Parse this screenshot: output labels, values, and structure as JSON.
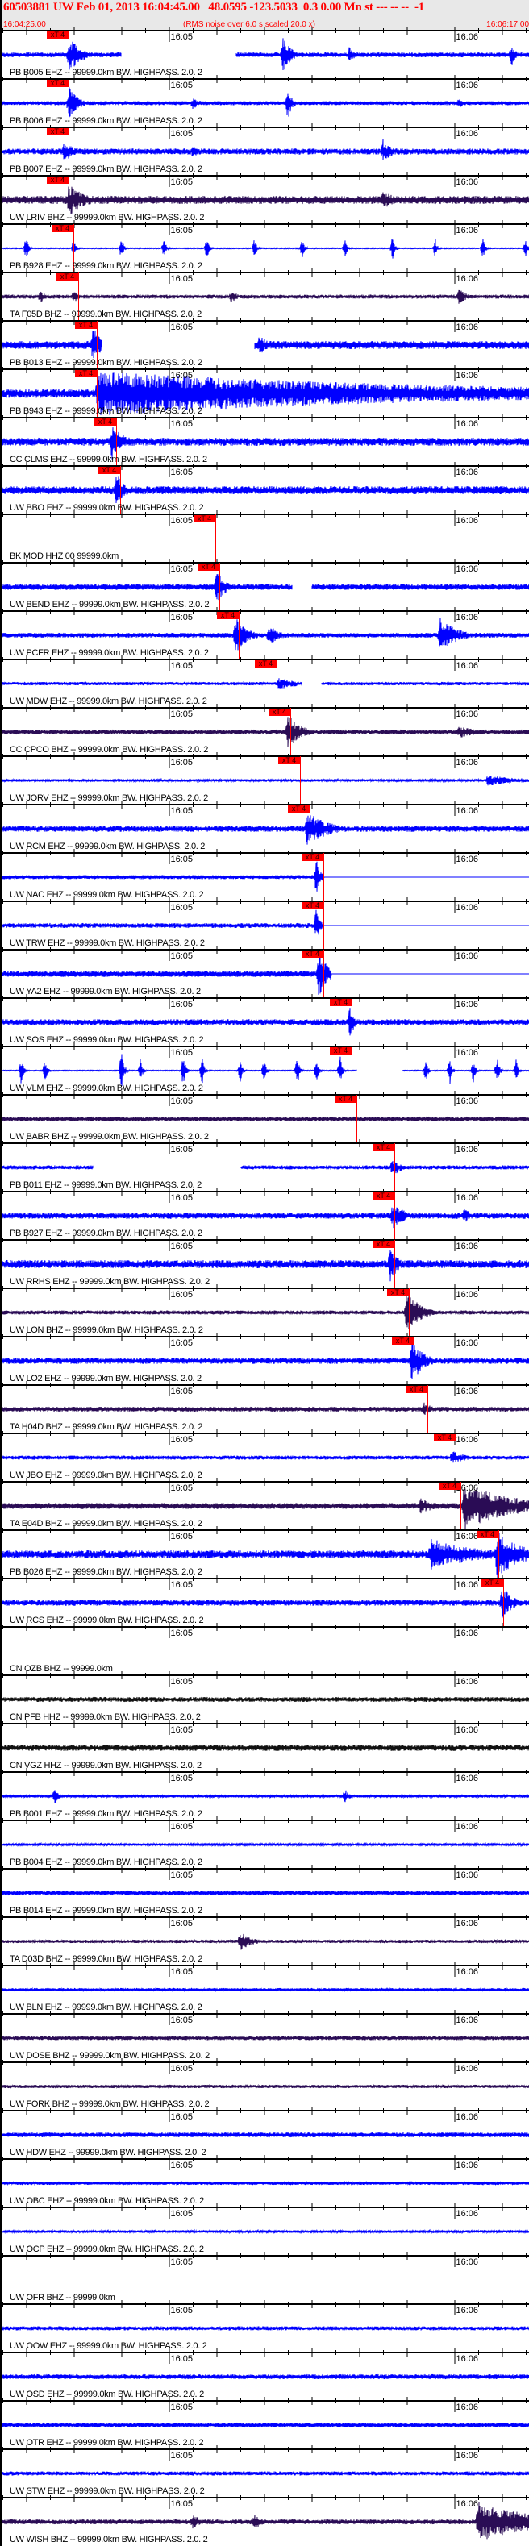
{
  "header": {
    "title": "60503881 UW Feb 01, 2013 16:04:45.00   48.0595 -123.5033  0.3 0.00 Mn st --- -- --  -1",
    "start_time": "16:04:25.00",
    "scale_note": "(RMS noise over 6.0 s scaled 20.0 x)",
    "end_time": "16:06:17.00"
  },
  "time_axis": {
    "duration_s": 112,
    "tick_interval_s": 5,
    "minute_labels": [
      {
        "label": "16:05",
        "t": 35
      },
      {
        "label": "16:06",
        "t": 95
      }
    ]
  },
  "marker_label": "xT 4",
  "colors": {
    "blue": "#0000ff",
    "dark": "#2a0c55",
    "black": "#111111",
    "marker": "#ff0000",
    "header_text": "#ff0000"
  },
  "panels": [
    {
      "label": "PB B005 EHZ -- 99999.0km BW. HIGHPASS. 2.0. 2",
      "color": "blue",
      "base": 0.12,
      "pick": 13.9,
      "ev": [
        [
          14,
          0.9,
          3
        ],
        [
          59,
          0.9,
          2
        ],
        [
          73,
          0.5,
          1
        ],
        [
          107,
          0.6,
          1
        ]
      ],
      "gaps": [
        [
          25,
          49
        ]
      ]
    },
    {
      "label": "PB B006 EHZ -- 99999.0km BW. HIGHPASS. 2.0. 2",
      "color": "blue",
      "base": 0.1,
      "pick": 13.9,
      "ev": [
        [
          14,
          0.9,
          2
        ],
        [
          40,
          0.3,
          2
        ],
        [
          60,
          0.9,
          1
        ],
        [
          96,
          0.3,
          1
        ]
      ]
    },
    {
      "label": "PB B007 EHZ -- 99999.0km BW. HIGHPASS. 2.0. 2",
      "color": "blue",
      "base": 0.15,
      "pick": 13.9,
      "ev": [
        [
          13,
          0.5,
          3
        ],
        [
          40,
          0.3,
          2
        ],
        [
          80,
          0.6,
          2
        ]
      ]
    },
    {
      "label": "UW LRIV BHZ -- 99999.0km BW. HIGHPASS. 2.0. 2",
      "color": "dark",
      "base": 0.2,
      "pick": 13.9,
      "ev": [
        [
          14,
          0.8,
          4
        ],
        [
          80,
          0.5,
          3
        ]
      ]
    },
    {
      "label": "PB B928 EHZ -- 99999.0km BW. HIGHPASS. 2.0. 2",
      "color": "blue",
      "base": 0.02,
      "pick": 14.9,
      "ev": [
        [
          5,
          0.6,
          0.5
        ],
        [
          15,
          0.5,
          0.5
        ],
        [
          25,
          0.6,
          0.5
        ],
        [
          34,
          0.5,
          0.5
        ],
        [
          43,
          0.6,
          0.5
        ],
        [
          53,
          0.5,
          0.5
        ],
        [
          63,
          0.6,
          0.5
        ],
        [
          72,
          0.5,
          0.5
        ],
        [
          82,
          0.6,
          0.5
        ],
        [
          91,
          0.5,
          0.5
        ],
        [
          101,
          0.6,
          0.5
        ],
        [
          110,
          0.5,
          0.5
        ]
      ]
    },
    {
      "label": "TA F05D BHZ -- 99999.0km BW. HIGHPASS. 2.0. 2",
      "color": "dark",
      "base": 0.1,
      "pick": 15.9,
      "ev": [
        [
          8,
          0.4,
          1
        ],
        [
          15,
          0.4,
          1
        ],
        [
          48,
          0.3,
          2
        ],
        [
          96,
          0.4,
          2
        ]
      ]
    },
    {
      "label": "PB B013 EHZ -- 99999.0km BW. HIGHPASS. 2.0. 2",
      "color": "blue",
      "base": 0.2,
      "pick": 19.8,
      "ev": [
        [
          19,
          1,
          2
        ],
        [
          54,
          0.6,
          2
        ]
      ],
      "gaps": [
        [
          21,
          53
        ]
      ]
    },
    {
      "label": "PB B943 EHZ -- 99999.0km BW. HIGHPASS. 2.0. 2",
      "color": "blue",
      "base": 0.22,
      "pick": 19.8,
      "ev": [
        [
          20,
          1.1,
          90
        ]
      ]
    },
    {
      "label": "CC CLMS EHZ -- 99999.0km BW. HIGHPASS. 2.0. 2",
      "color": "blue",
      "base": 0.2,
      "pick": 23.9,
      "ev": [
        [
          23,
          0.9,
          3
        ]
      ]
    },
    {
      "label": "UW BBO EHZ -- 99999.0km BW. HIGHPASS. 2.0. 2",
      "color": "blue",
      "base": 0.2,
      "pick": 24.7,
      "ev": [
        [
          24,
          0.9,
          2
        ]
      ]
    },
    {
      "label": "BK MOD HHZ 00 99999.0km",
      "color": "blue",
      "base": 0,
      "pick": 44.7,
      "empty": true
    },
    {
      "label": "UW BEND EHZ -- 99999.0km BW. HIGHPASS. 2.0. 2",
      "color": "blue",
      "base": 0.15,
      "pick": 45.6,
      "ev": [
        [
          45,
          0.9,
          2
        ]
      ],
      "gaps": [
        [
          61,
          65
        ]
      ]
    },
    {
      "label": "UW PCFR EHZ -- 99999.0km BW. HIGHPASS. 2.0. 2",
      "color": "blue",
      "base": 0.12,
      "pick": 49.7,
      "ev": [
        [
          49,
          0.9,
          3
        ],
        [
          56,
          0.5,
          3
        ],
        [
          92,
          0.9,
          4
        ]
      ]
    },
    {
      "label": "UW MDW EHZ -- 99999.0km BW. HIGHPASS. 2.0. 2",
      "color": "blue",
      "base": 0.08,
      "pick": 57.6,
      "ev": [
        [
          58,
          0.3,
          5
        ]
      ],
      "gaps": [
        [
          63,
          67
        ]
      ]
    },
    {
      "label": "CC CPCO BHZ -- 99999.0km BW. HIGHPASS. 2.0. 2",
      "color": "dark",
      "base": 0.12,
      "pick": 60.5,
      "ev": [
        [
          60,
          0.9,
          3
        ],
        [
          96,
          0.3,
          5
        ]
      ]
    },
    {
      "label": "UW JORV EHZ -- 99999.0km BW. HIGHPASS. 2.0. 2",
      "color": "blue",
      "base": 0.06,
      "pick": 62.5,
      "ev": [
        [
          102,
          0.3,
          8
        ]
      ]
    },
    {
      "label": "UW RCM EHZ -- 99999.0km BW. HIGHPASS. 2.0. 2",
      "color": "blue",
      "base": 0.15,
      "pick": 64.6,
      "ev": [
        [
          64,
          0.9,
          5
        ],
        [
          113,
          0.9,
          3
        ]
      ]
    },
    {
      "label": "UW NAC EHZ -- 99999.0km BW. HIGHPASS. 2.0. 2",
      "color": "blue",
      "base": 0.1,
      "pick": 67.5,
      "ev": [
        [
          66,
          0.9,
          1
        ]
      ],
      "flat_after": 67.5
    },
    {
      "label": "UW TRW EHZ -- 99999.0km BW. HIGHPASS. 2.0. 2",
      "color": "blue",
      "base": 0.12,
      "pick": 67.5,
      "ev": [
        [
          66,
          0.9,
          1
        ]
      ],
      "flat_after": 67.5
    },
    {
      "label": "UW YA2 EHZ -- 99999.0km BW. HIGHPASS. 2.0. 2",
      "color": "blue",
      "base": 0.15,
      "pick": 67.5,
      "ev": [
        [
          66.5,
          1.3,
          2
        ]
      ],
      "flat_after": 69
    },
    {
      "label": "UW SOS EHZ -- 99999.0km BW. HIGHPASS. 2.0. 2",
      "color": "blue",
      "base": 0.15,
      "pick": 73.4,
      "ev": [
        [
          73,
          0.9,
          1
        ]
      ]
    },
    {
      "label": "UW VLM EHZ -- 99999.0km BW. HIGHPASS. 2.0. 2",
      "color": "blue",
      "base": 0.02,
      "pick": 73.4,
      "ev": [
        [
          4,
          0.8,
          0.5
        ],
        [
          9,
          0.6,
          0.5
        ],
        [
          25,
          1,
          0.6
        ],
        [
          29,
          0.6,
          0.5
        ],
        [
          38,
          1,
          0.6
        ],
        [
          42,
          0.7,
          0.5
        ],
        [
          50,
          0.6,
          0.5
        ],
        [
          55,
          0.6,
          0.5
        ],
        [
          62,
          0.8,
          0.5
        ],
        [
          66,
          0.6,
          0.5
        ],
        [
          71,
          0.8,
          0.5
        ],
        [
          89,
          0.6,
          0.5
        ],
        [
          94,
          0.8,
          0.5
        ],
        [
          99,
          0.6,
          0.5
        ],
        [
          104,
          0.7,
          0.5
        ],
        [
          108,
          0.6,
          0.5
        ]
      ],
      "gaps": [
        [
          74.5,
          84
        ]
      ]
    },
    {
      "label": "UW BABR BHZ -- 99999.0km BW. HIGHPASS. 2.0. 2",
      "color": "dark",
      "base": 0.12,
      "pick": 74.4
    },
    {
      "label": "PB B011 EHZ -- 99999.0km BW. HIGHPASS. 2.0. 2",
      "color": "blue",
      "base": 0.1,
      "pick": 82.4,
      "ev": [
        [
          82,
          0.5,
          2
        ]
      ],
      "gaps": [
        [
          19,
          50
        ]
      ]
    },
    {
      "label": "PB B927 EHZ -- 99999.0km BW. HIGHPASS. 2.0. 2",
      "color": "blue",
      "base": 0.15,
      "pick": 82.4,
      "ev": [
        [
          82,
          0.7,
          3
        ],
        [
          97,
          0.4,
          2
        ]
      ]
    },
    {
      "label": "UW RRHS EHZ -- 99999.0km BW. HIGHPASS. 2.0. 2",
      "color": "blue",
      "base": 0.2,
      "pick": 82.4,
      "ev": [
        [
          81.5,
          0.9,
          2
        ]
      ]
    },
    {
      "label": "UW LON BHZ -- 99999.0km BW. HIGHPASS. 2.0. 2",
      "color": "dark",
      "base": 0.1,
      "pick": 85.4,
      "ev": [
        [
          85,
          1.2,
          3
        ]
      ]
    },
    {
      "label": "UW LO2 EHZ -- 99999.0km BW. HIGHPASS. 2.0. 2",
      "color": "blue",
      "base": 0.15,
      "pick": 86.4,
      "ev": [
        [
          86,
          1.1,
          3
        ]
      ]
    },
    {
      "label": "TA H04D BHZ -- 99999.0km BW. HIGHPASS. 2.0. 2",
      "color": "dark",
      "base": 0.12,
      "pick": 89.3,
      "ev": [
        [
          88.5,
          0.4,
          2
        ]
      ]
    },
    {
      "label": "UW JBO EHZ -- 99999.0km BW. HIGHPASS. 2.0. 2",
      "color": "blue",
      "base": 0.1,
      "pick": 95.3,
      "ev": [
        [
          94.5,
          0.4,
          3
        ]
      ]
    },
    {
      "label": "TA E04D BHZ -- 99999.0km BW. HIGHPASS. 2.0. 2",
      "color": "dark",
      "base": 0.15,
      "pick": 96.3,
      "ev": [
        [
          97,
          1.2,
          12
        ],
        [
          88,
          0.5,
          3
        ]
      ]
    },
    {
      "label": "PB B026 EHZ -- 99999.0km BW. HIGHPASS. 2.0. 2",
      "color": "blue",
      "base": 0.2,
      "pick": 104.2,
      "ev": [
        [
          90,
          0.8,
          12
        ],
        [
          104,
          1.2,
          6
        ]
      ]
    },
    {
      "label": "UW RCS EHZ -- 99999.0km BW. HIGHPASS. 2.0. 2",
      "color": "blue",
      "base": 0.15,
      "pick": 105.2,
      "ev": [
        [
          105,
          0.8,
          3
        ]
      ]
    },
    {
      "label": "CN OZB BHZ -- 99999.0km",
      "color": "black",
      "base": 0,
      "empty": true
    },
    {
      "label": "CN PFB HHZ -- 99999.0km BW. HIGHPASS. 2.0. 2",
      "color": "black",
      "base": 0.12
    },
    {
      "label": "CN VGZ HHZ -- 99999.0km BW. HIGHPASS. 2.0. 2",
      "color": "black",
      "base": 0.15
    },
    {
      "label": "PB B001 EHZ -- 99999.0km BW. HIGHPASS. 2.0. 2",
      "color": "blue",
      "base": 0.06,
      "ev": [
        [
          11,
          0.4,
          1
        ],
        [
          72,
          0.4,
          1
        ]
      ]
    },
    {
      "label": "PB B004 EHZ -- 99999.0km BW. HIGHPASS. 2.0. 2",
      "color": "blue",
      "base": 0.05
    },
    {
      "label": "PB B014 EHZ -- 99999.0km BW. HIGHPASS. 2.0. 2",
      "color": "blue",
      "base": 0.12
    },
    {
      "label": "TA D03D BHZ -- 99999.0km BW. HIGHPASS. 2.0. 2",
      "color": "dark",
      "base": 0.08,
      "ev": [
        [
          50,
          0.5,
          3
        ]
      ]
    },
    {
      "label": "UW BLN EHZ -- 99999.0km BW. HIGHPASS. 2.0. 2",
      "color": "blue",
      "base": 0.08
    },
    {
      "label": "UW DOSE BHZ -- 99999.0km BW. HIGHPASS. 2.0. 2",
      "color": "dark",
      "base": 0.1
    },
    {
      "label": "UW FORK BHZ -- 99999.0km BW. HIGHPASS. 2.0. 2",
      "color": "dark",
      "base": 0.08
    },
    {
      "label": "UW HDW EHZ -- 99999.0km BW. HIGHPASS. 2.0. 2",
      "color": "blue",
      "base": 0.12
    },
    {
      "label": "UW OBC EHZ -- 99999.0km BW. HIGHPASS. 2.0. 2",
      "color": "blue",
      "base": 0.08
    },
    {
      "label": "UW OCP EHZ -- 99999.0km BW. HIGHPASS. 2.0. 2",
      "color": "blue",
      "base": 0.06
    },
    {
      "label": "UW OFR BHZ -- 99999.0km",
      "color": "blue",
      "base": 0,
      "empty": true
    },
    {
      "label": "UW OOW EHZ -- 99999.0km BW. HIGHPASS. 2.0. 2",
      "color": "blue",
      "base": 0.1
    },
    {
      "label": "UW OSD EHZ -- 99999.0km BW. HIGHPASS. 2.0. 2",
      "color": "blue",
      "base": 0.12
    },
    {
      "label": "UW OTR EHZ -- 99999.0km BW. HIGHPASS. 2.0. 2",
      "color": "blue",
      "base": 0.12
    },
    {
      "label": "UW STW EHZ -- 99999.0km BW. HIGHPASS. 2.0. 2",
      "color": "blue",
      "base": 0.1
    },
    {
      "label": "UW WISH BHZ -- 99999.0km BW. HIGHPASS. 2.0. 2",
      "color": "dark",
      "base": 0.12,
      "ev": [
        [
          40,
          0.4,
          2
        ],
        [
          53,
          0.4,
          2
        ],
        [
          100,
          1,
          15
        ]
      ]
    }
  ]
}
